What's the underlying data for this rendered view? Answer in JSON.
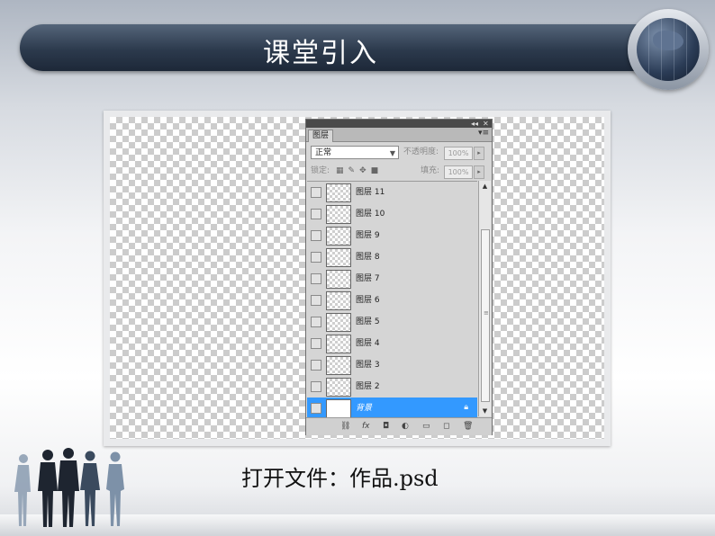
{
  "slide": {
    "title": "课堂引入",
    "caption": "打开文件：作品.psd"
  },
  "panel": {
    "tab_label": "图层",
    "tab_menu": "▾≡",
    "window_controls": {
      "collapse": "◂◂",
      "close": "✕"
    },
    "blend_mode": "正常",
    "opacity_label": "不透明度:",
    "opacity_value": "100%",
    "lock_label": "锁定:",
    "fill_label": "填充:",
    "fill_value": "100%",
    "layers": [
      {
        "name": "图层 11",
        "selected": false
      },
      {
        "name": "图层 10",
        "selected": false
      },
      {
        "name": "图层 9",
        "selected": false
      },
      {
        "name": "图层 8",
        "selected": false
      },
      {
        "name": "图层 7",
        "selected": false
      },
      {
        "name": "图层 6",
        "selected": false
      },
      {
        "name": "图层 5",
        "selected": false
      },
      {
        "name": "图层 4",
        "selected": false
      },
      {
        "name": "图层 3",
        "selected": false
      },
      {
        "name": "图层 2",
        "selected": false
      },
      {
        "name": "背景",
        "selected": true
      }
    ],
    "footer_icons": [
      "link-icon",
      "fx-icon",
      "mask-icon",
      "adjustment-icon",
      "group-icon",
      "new-layer-icon",
      "trash-icon"
    ]
  },
  "colors": {
    "selected_layer": "#3399ff",
    "title_bar": "#2c3a4d"
  }
}
